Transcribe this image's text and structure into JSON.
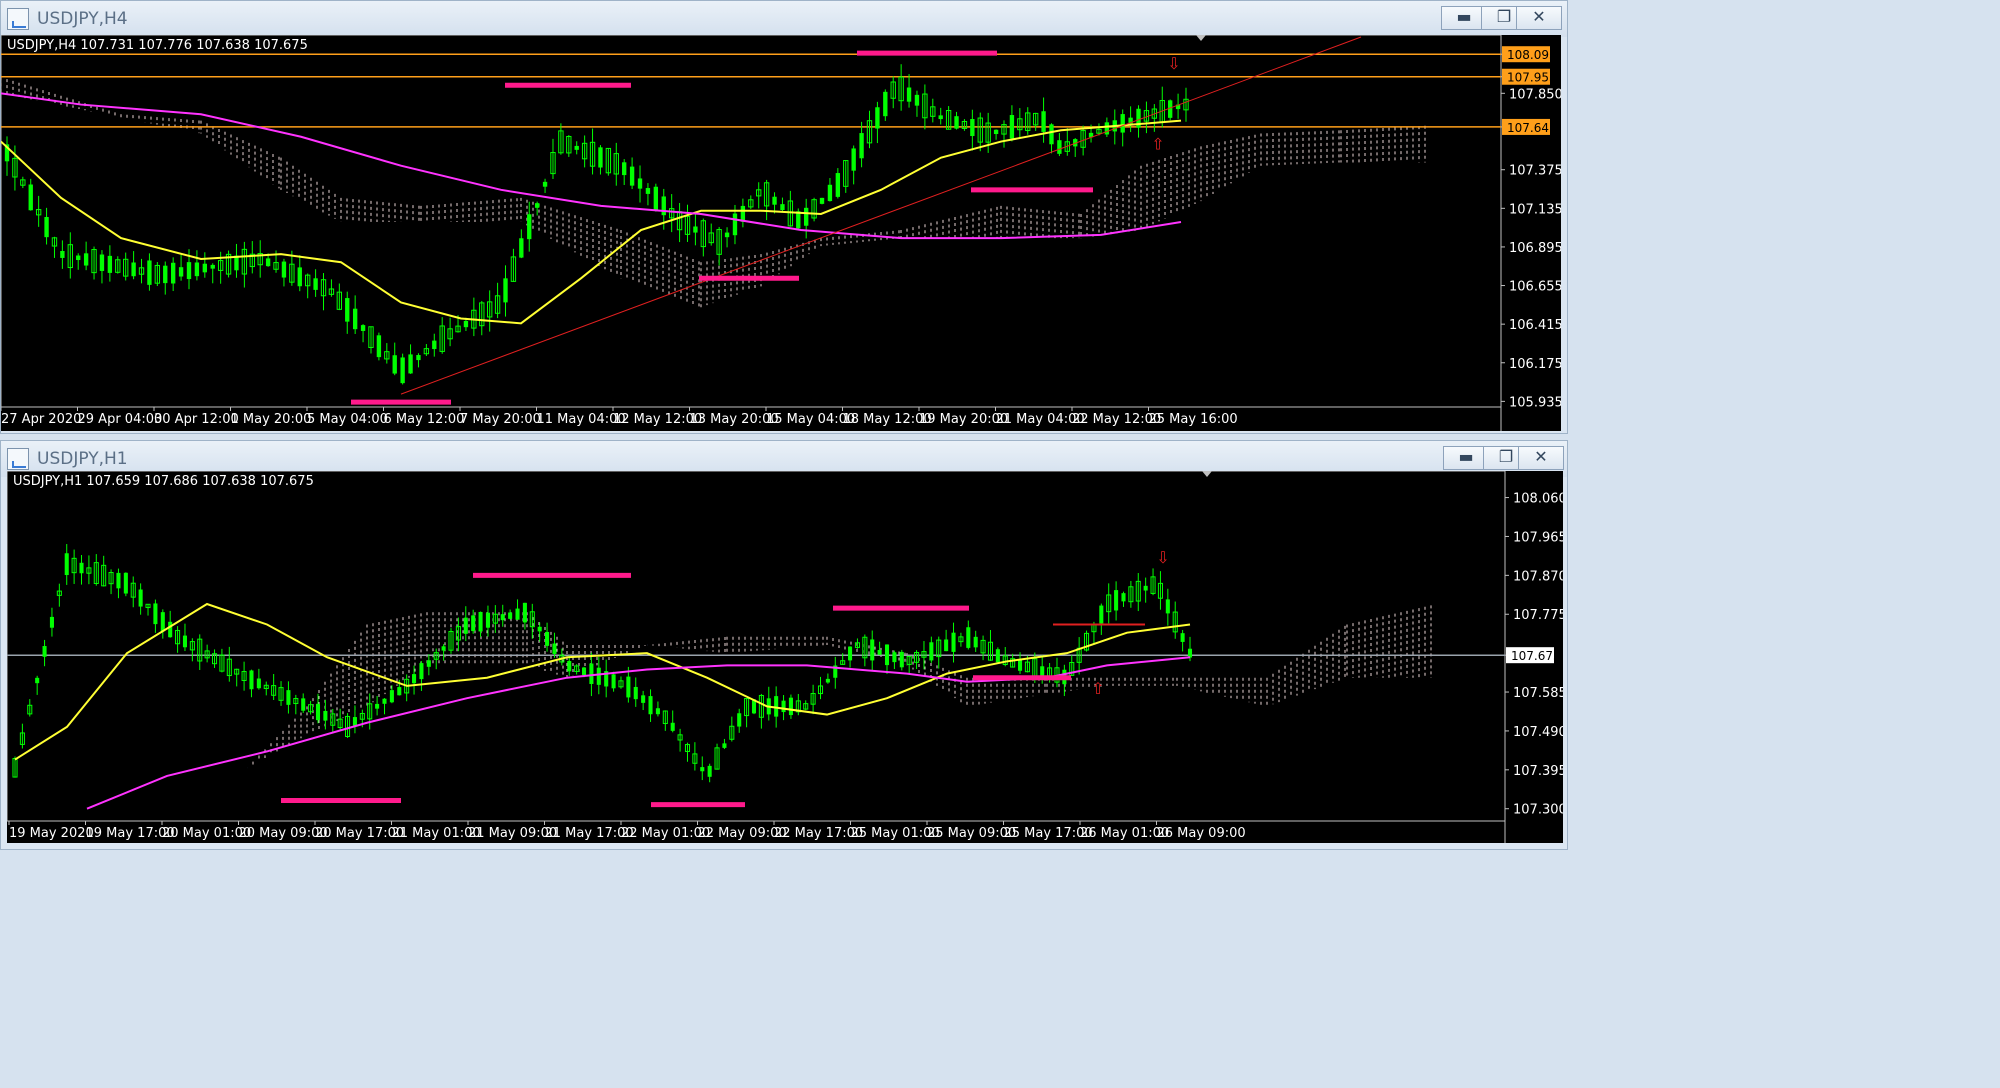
{
  "windows": [
    {
      "title": "USDJPY,H4",
      "buttons": {
        "minimize": "▬",
        "restore": "❐",
        "close": "✕"
      }
    },
    {
      "title": "USDJPY,H1",
      "buttons": {
        "minimize": "▬",
        "restore": "❐",
        "close": "✕"
      }
    }
  ],
  "chart_data": [
    {
      "type": "candlestick",
      "symbol": "USDJPY,H4",
      "ohlc_header": "USDJPY,H4  107.731 107.776 107.638 107.675",
      "y_ticks": [
        "108.093",
        "107.953",
        "107.850",
        "107.641",
        "107.375",
        "107.135",
        "106.895",
        "106.655",
        "106.415",
        "106.175",
        "105.935"
      ],
      "y_range": [
        105.9,
        108.2
      ],
      "x_labels": [
        "27 Apr 2020",
        "29 Apr 04:00",
        "30 Apr 12:00",
        "1 May 20:00",
        "5 May 04:00",
        "6 May 12:00",
        "7 May 20:00",
        "11 May 04:00",
        "12 May 12:00",
        "13 May 20:00",
        "15 May 04:00",
        "18 May 12:00",
        "19 May 20:00",
        "21 May 04:00",
        "22 May 12:00",
        "25 May 16:00"
      ],
      "horizontal_levels": [
        {
          "value": 108.093,
          "color": "#ff9f1a"
        },
        {
          "value": 107.953,
          "color": "#ff9f1a"
        },
        {
          "value": 107.641,
          "color": "#ff9f1a"
        }
      ],
      "colors": {
        "bull": "#00ff00",
        "bear": "#00ff00",
        "ma_fast": "#ffff33",
        "ma_slow": "#ff33ff",
        "trendline": "#e02020",
        "zigzag": "#2aa8ff",
        "marker": "#ff1a8c",
        "cloud_up": "#e9d4d4",
        "cloud_down": "#5a7dd8"
      }
    },
    {
      "type": "candlestick",
      "symbol": "USDJPY,H1",
      "ohlc_header": "USDJPY,H1  107.659 107.686 107.638 107.675",
      "y_ticks": [
        "108.060",
        "107.965",
        "107.870",
        "107.775",
        "107.675",
        "107.585",
        "107.490",
        "107.395",
        "107.300"
      ],
      "y_range": [
        107.27,
        108.12
      ],
      "x_labels": [
        "19 May 2020",
        "19 May 17:00",
        "20 May 01:00",
        "20 May 09:00",
        "20 May 17:00",
        "21 May 01:00",
        "21 May 09:00",
        "21 May 17:00",
        "22 May 01:00",
        "22 May 09:00",
        "22 May 17:00",
        "25 May 01:00",
        "25 May 09:00",
        "25 May 17:00",
        "26 May 01:00",
        "26 May 09:00"
      ],
      "horizontal_levels": [
        {
          "value": 107.675,
          "color": "#9aa3ad"
        }
      ],
      "colors": {
        "bull": "#00ff00",
        "bear": "#00ff00",
        "ma_fast": "#ffff33",
        "ma_slow": "#ff33ff",
        "zigzag": "#2aa8ff",
        "marker": "#ff1a8c",
        "cloud_up": "#e9d4d4",
        "cloud_down": "#5a7dd8"
      }
    }
  ]
}
